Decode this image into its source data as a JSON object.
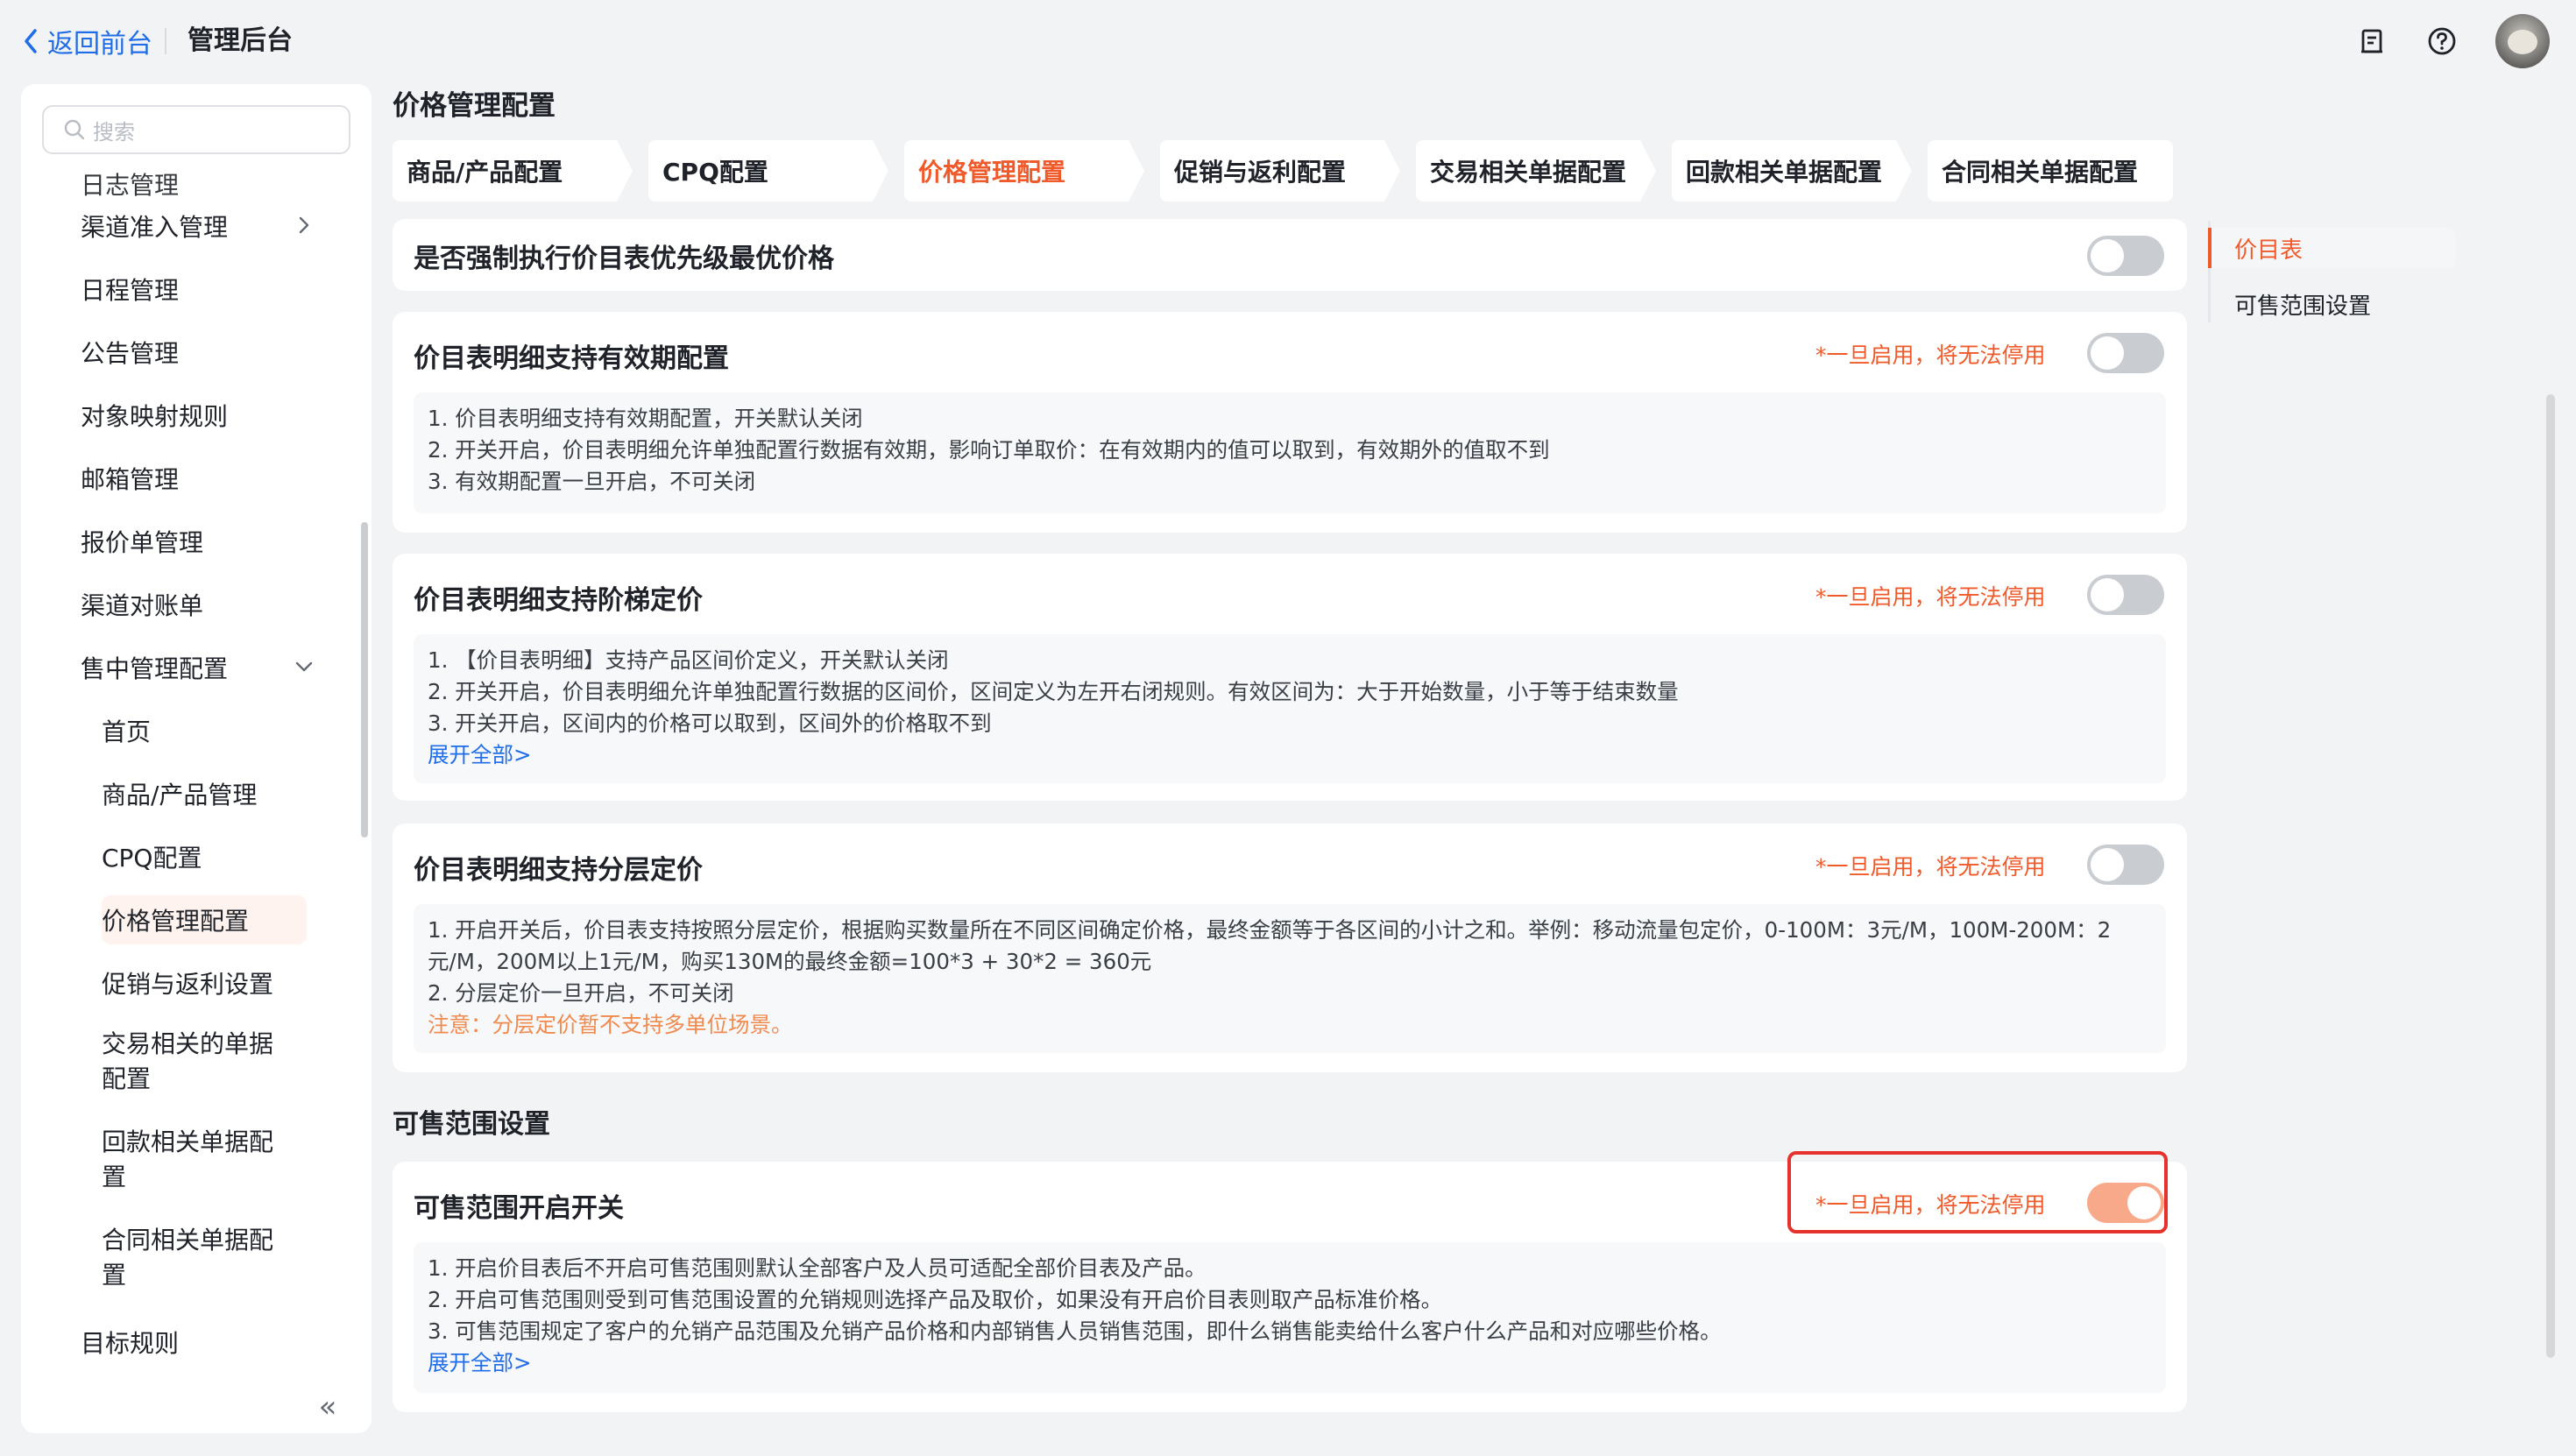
{
  "topbar": {
    "back_label": "返回前台",
    "title": "管理后台",
    "icons": [
      "document-icon",
      "help-icon",
      "avatar"
    ]
  },
  "sidebar": {
    "search_placeholder": "搜索",
    "items": [
      {
        "label": "日志管理"
      },
      {
        "label": "渠道准入管理",
        "has_children": true
      },
      {
        "label": "日程管理"
      },
      {
        "label": "公告管理"
      },
      {
        "label": "对象映射规则"
      },
      {
        "label": "邮箱管理"
      },
      {
        "label": "报价单管理"
      },
      {
        "label": "渠道对账单"
      },
      {
        "label": "售中管理配置",
        "expanded": true
      },
      {
        "label": "首页"
      },
      {
        "label": "商品/产品管理"
      },
      {
        "label": "CPQ配置"
      },
      {
        "label": "价格管理配置",
        "active": true
      },
      {
        "label": "促销与返利设置"
      },
      {
        "label": "交易相关的单据配置"
      },
      {
        "label": "回款相关单据配置"
      },
      {
        "label": "合同相关单据配置"
      },
      {
        "label": "目标规则"
      }
    ],
    "collapse_label": "«"
  },
  "main": {
    "heading": "价格管理配置",
    "tabs": [
      {
        "label": "商品/产品配置"
      },
      {
        "label": "CPQ配置"
      },
      {
        "label": "价格管理配置",
        "active": true
      },
      {
        "label": "促销与返利配置"
      },
      {
        "label": "交易相关单据配置"
      },
      {
        "label": "回款相关单据配置"
      },
      {
        "label": "合同相关单据配置"
      }
    ],
    "warn_text": "*一旦启用，将无法停用",
    "cards": [
      {
        "title": "是否强制执行价目表优先级最优价格",
        "toggle_on": false
      },
      {
        "title": "价目表明细支持有效期配置",
        "warn": "*一旦启用，将无法停用",
        "toggle_on": false,
        "lines": [
          "1. 价目表明细支持有效期配置，开关默认关闭",
          "2. 开关开启，价目表明细允许单独配置行数据有效期，影响订单取价：在有效期内的值可以取到，有效期外的值取不到",
          "3. 有效期配置一旦开启，不可关闭"
        ]
      },
      {
        "title": "价目表明细支持阶梯定价",
        "warn": "*一旦启用，将无法停用",
        "toggle_on": false,
        "lines": [
          "1. 【价目表明细】支持产品区间价定义，开关默认关闭",
          "2. 开关开启，价目表明细允许单独配置行数据的区间价，区间定义为左开右闭规则。有效区间为：大于开始数量，小于等于结束数量",
          "3. 开关开启，区间内的价格可以取到，区间外的价格取不到"
        ],
        "expand_link": "展开全部>"
      },
      {
        "title": "价目表明细支持分层定价",
        "warn": "*一旦启用，将无法停用",
        "toggle_on": false,
        "lines": [
          "1. 开启开关后，价目表支持按照分层定价，根据购买数量所在不同区间确定价格，最终金额等于各区间的小计之和。举例：移动流量包定价，0-100M：3元/M，100M-200M：2元/M，200M以上1元/M，购买130M的最终金额=100*3 + 30*2 = 360元",
          "2. 分层定价一旦开启，不可关闭"
        ],
        "note": "注意：分层定价暂不支持多单位场景。"
      }
    ],
    "section2_label": "可售范围设置",
    "card5": {
      "title": "可售范围开启开关",
      "warn": "*一旦启用，将无法停用",
      "toggle_on": true,
      "lines": [
        "1. 开启价目表后不开启可售范围则默认全部客户及人员可适配全部价目表及产品。",
        "2. 开启可售范围则受到可售范围设置的允销规则选择产品及取价，如果没有开启价目表则取产品标准价格。",
        "3. 可售范围规定了客户的允销产品范围及允销产品价格和内部销售人员销售范围，即什么销售能卖给什么客户什么产品和对应哪些价格。"
      ],
      "expand_link": "展开全部>"
    }
  },
  "anchor_nav": {
    "items": [
      {
        "label": "价目表",
        "active": true
      },
      {
        "label": "可售范围设置"
      }
    ]
  },
  "colors": {
    "accent": "#f05a2a",
    "link": "#1f6de8",
    "highlight_border": "#e5322d",
    "toggle_off": "#c9ccd1",
    "toggle_on": "#f7a98a"
  }
}
